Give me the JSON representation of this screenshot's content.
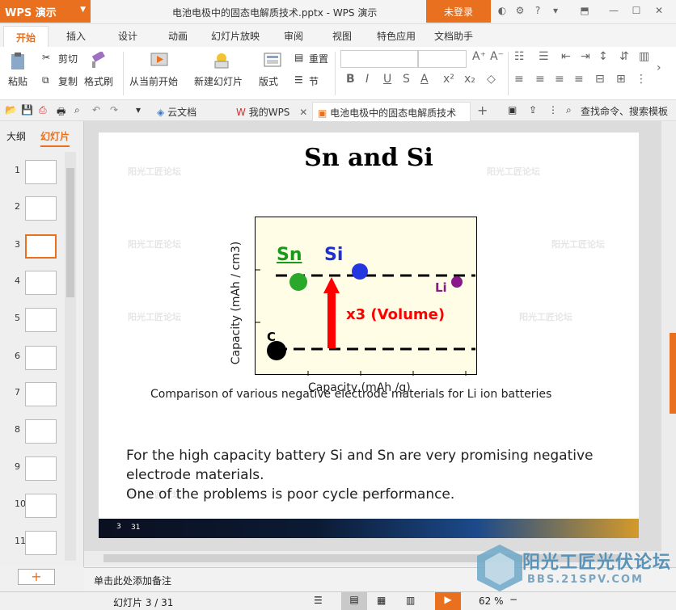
{
  "app": {
    "name": "WPS 演示",
    "doc_title": "电池电极中的固态电解质技术.pptx - WPS 演示",
    "login": "未登录"
  },
  "menu_tabs": [
    "开始",
    "插入",
    "设计",
    "动画",
    "幻灯片放映",
    "审阅",
    "视图",
    "特色应用",
    "文档助手"
  ],
  "ribbon": {
    "paste": "粘贴",
    "cut": "剪切",
    "copy": "复制",
    "format_painter": "格式刷",
    "from_current": "从当前开始",
    "new_slide": "新建幻灯片",
    "layout": "版式",
    "reset": "重置",
    "section": "节"
  },
  "quickbar": {
    "tabs": [
      "云文档",
      "我的WPS",
      "电池电极中的固态电解质技术"
    ],
    "search": "查找命令、搜索模板"
  },
  "panel_tabs": {
    "outline": "大纲",
    "slides": "幻灯片"
  },
  "thumbnails": [
    "1",
    "2",
    "3",
    "4",
    "5",
    "6",
    "7",
    "8",
    "9",
    "10",
    "11"
  ],
  "slide": {
    "title": "Sn and Si",
    "chart": {
      "ylabel": "Capacity (mAh / cm3)",
      "xlabel": "Capacity (mAh /g)",
      "labels": {
        "sn": "Sn",
        "si": "Si",
        "li": "Li",
        "c": "C",
        "arrow": "x3 (Volume)"
      }
    },
    "caption": "Comparison of   various negative electrode materials for Li ion batteries",
    "body": [
      "For the high capacity battery Si and Sn are very promising negative electrode materials.",
      "One of the problems is poor cycle performance."
    ],
    "footer_page": "3",
    "footer_total": "31",
    "watermark": "阳光工匠论坛"
  },
  "notes_placeholder": "单击此处添加备注",
  "status": {
    "slide_counter": "幻灯片 3 / 31",
    "zoom": "62 %"
  },
  "brand": {
    "logo_text": "阳光工匠光伏论坛",
    "url": "BBS.21SPV.COM"
  },
  "colors": {
    "accent": "#e8701f",
    "sn": "#1a9a1a",
    "si": "#1f2fd6",
    "li": "#8a1a8a",
    "arrow": "#ff0000"
  }
}
